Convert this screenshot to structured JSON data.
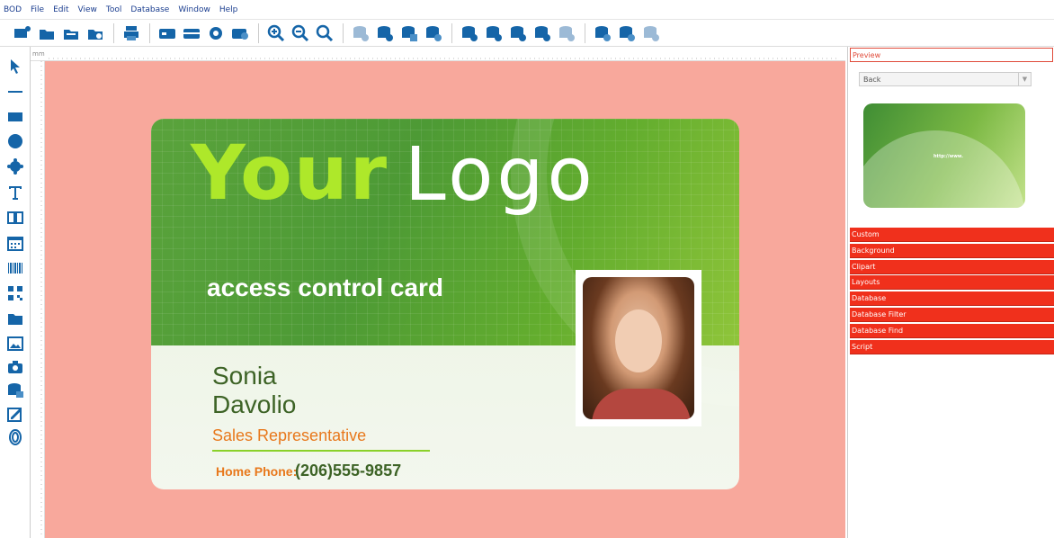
{
  "menu": [
    "BOD",
    "File",
    "Edit",
    "View",
    "Tool",
    "Database",
    "Window",
    "Help"
  ],
  "ruler_unit": "mm",
  "card": {
    "logo_part1": "Your",
    "logo_part2": "Logo",
    "title": "access control card",
    "first_name": "Sonia",
    "last_name": "Davolio",
    "job_title": "Sales Representative",
    "phone_label": "Home Phone:",
    "phone_value": "(206)555-9857"
  },
  "right_panel": {
    "preview_label": "Preview",
    "side_select": "Back",
    "preview_url": "http://www.",
    "accordion": [
      "Custom",
      "Background",
      "Clipart",
      "Layouts",
      "Database",
      "Database Filter",
      "Database Find",
      "Script"
    ]
  },
  "colors": {
    "accent": "#f0301c",
    "canvas": "#f8a89c",
    "icon_blue": "#1565a8"
  }
}
